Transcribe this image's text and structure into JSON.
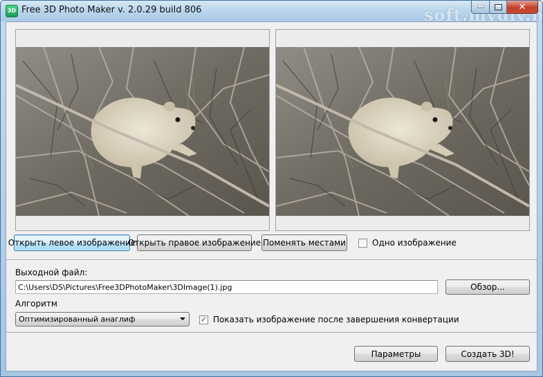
{
  "window": {
    "icon_text": "3D",
    "title": "Free 3D Photo Maker  v. 2.0.29 build 806",
    "watermark": "soft.mydiv.net",
    "close_glyph": "✕"
  },
  "previews": {
    "left_name": "left-image-preview",
    "right_name": "right-image-preview"
  },
  "buttons": {
    "open_left": "Открыть левое изображение",
    "open_right": "Открыть правое изображение",
    "swap": "Поменять местами",
    "browse": "Обзор...",
    "params": "Параметры",
    "create": "Создать 3D!"
  },
  "single_image": {
    "label": "Одно изображение",
    "checked": false,
    "mark": ""
  },
  "output": {
    "label": "Выходной файл:",
    "path": "C:\\Users\\DS\\Pictures\\Free3DPhotoMaker\\3DImage(1).jpg"
  },
  "algorithm": {
    "label": "Алгоритм",
    "selected": "Оптимизированный анаглиф"
  },
  "show_after": {
    "label": "Показать изображение после завершения конвертации",
    "checked": true,
    "mark": "✓"
  },
  "colors": {
    "title_bar": "#bcd7ed",
    "client_bg": "#f0f0f0",
    "focus_button": "#a7d9f5",
    "close_button": "#c0402a"
  }
}
